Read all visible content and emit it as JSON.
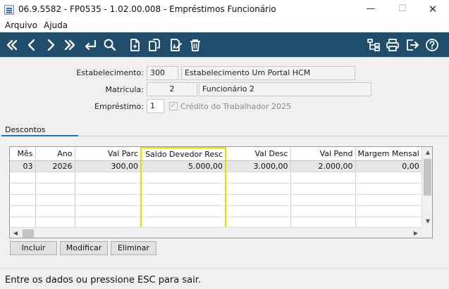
{
  "window": {
    "title": "06.9.5582 - FP0535 - 1.02.00.008 - Empréstimos Funcionário",
    "minimize": "—",
    "maximize": "☐",
    "close": "✕"
  },
  "menu": {
    "arquivo": "Arquivo",
    "ajuda": "Ajuda"
  },
  "toolbar": {
    "bg_color": "#1f4d6b",
    "icons": [
      "first-record-icon",
      "previous-record-icon",
      "next-record-icon",
      "last-record-icon",
      "return-icon",
      "search-icon",
      "new-document-icon",
      "copy-icon",
      "edit-icon",
      "delete-icon",
      "tree-structure-icon",
      "print-icon",
      "exit-icon",
      "help-icon"
    ]
  },
  "form": {
    "estabelecimento_label": "Estabelecimento:",
    "estabelecimento_code": "300",
    "estabelecimento_name": "Estabelecimento Um Portal HCM",
    "matricula_label": "Matrícula:",
    "matricula_code": "2",
    "matricula_name": "Funcionário 2",
    "emprestimo_label": "Empréstimo:",
    "emprestimo_code": "1",
    "credito_label": "Crédito do Trabalhador 2025",
    "credito_checked": true
  },
  "tabs": {
    "descontos": "Descontos"
  },
  "grid": {
    "columns": [
      "Mês",
      "Ano",
      "Val Parc",
      "Saldo Devedor Resc",
      "Val Desc",
      "Val Pend",
      "Margem Mensal"
    ],
    "rows": [
      [
        "03",
        "2026",
        "300,00",
        "5.000,00",
        "3.000,00",
        "2.000,00",
        "0,00"
      ]
    ],
    "highlight_color": "#e3e000"
  },
  "buttons": {
    "incluir": "Incluir",
    "modificar": "Modificar",
    "eliminar": "Eliminar"
  },
  "status": {
    "text": "Entre os dados ou pressione ESC para sair."
  }
}
